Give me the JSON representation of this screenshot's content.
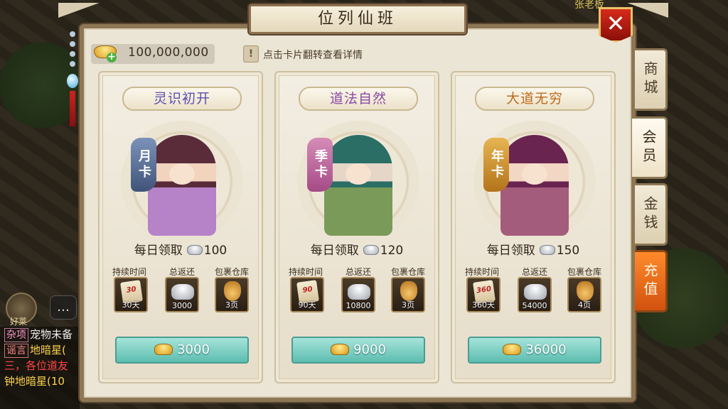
{
  "world": {
    "npc_name": "张老板",
    "hero_label": "好莱",
    "chat_lines": [
      {
        "tag": "杂项",
        "text": "宠物未备"
      },
      {
        "tag": "谣言",
        "text": "地暗星("
      },
      {
        "tag": "",
        "text": "三，各位道友"
      },
      {
        "tag": "",
        "text": "钟地暗星(10"
      }
    ]
  },
  "panel": {
    "title": "位列仙班",
    "gold_amount": "100,000,000",
    "hint_icon": "!",
    "hint": "点击卡片翻转查看详情",
    "close_label": "✕"
  },
  "tabs": [
    {
      "label": "商城"
    },
    {
      "label": "会员"
    },
    {
      "label": "金钱"
    },
    {
      "label": "充值"
    }
  ],
  "cards": [
    {
      "title": "灵识初开",
      "tag": "月卡",
      "daily_label": "每日领取",
      "daily_amount": "100",
      "stat_labels": [
        "持续时间",
        "总返还",
        "包裹仓库"
      ],
      "duration_icon_text": "30",
      "duration": "30天",
      "total_return": "3000",
      "bag_pages": "3页",
      "price": "3000"
    },
    {
      "title": "道法自然",
      "tag": "季卡",
      "daily_label": "每日领取",
      "daily_amount": "120",
      "stat_labels": [
        "持续时间",
        "总返还",
        "包裹仓库"
      ],
      "duration_icon_text": "90",
      "duration": "90天",
      "total_return": "10800",
      "bag_pages": "3页",
      "price": "9000"
    },
    {
      "title": "大道无穷",
      "tag": "年卡",
      "daily_label": "每日领取",
      "daily_amount": "150",
      "stat_labels": [
        "持续时间",
        "总返还",
        "包裹仓库"
      ],
      "duration_icon_text": "360",
      "duration": "360天",
      "total_return": "54000",
      "bag_pages": "4页",
      "price": "36000"
    }
  ],
  "colors": {
    "accent_teal": "#5dbdb0",
    "close_red": "#d62a1a",
    "active_tab_orange": "#ff8a2a"
  }
}
